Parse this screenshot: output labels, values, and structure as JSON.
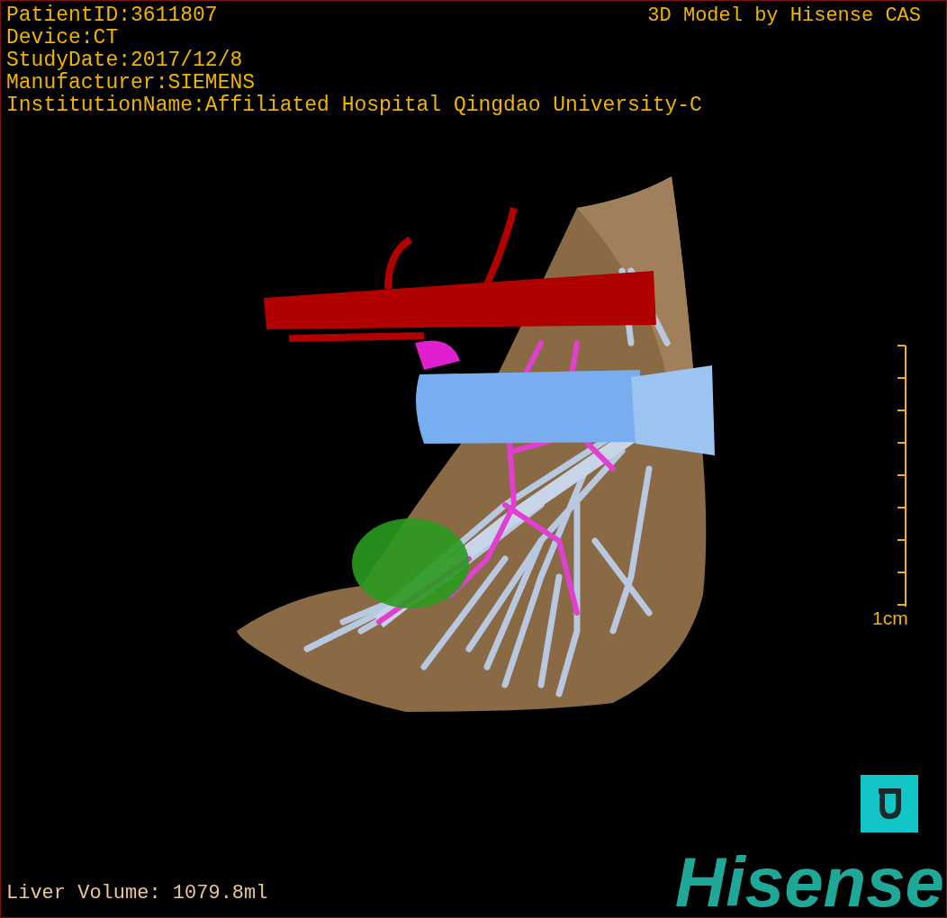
{
  "patient_info": [
    "PatientID:3611807",
    "Device:CT",
    "StudyDate:2017/12/8",
    "Manufacturer:SIEMENS",
    "InstitutionName:Affiliated Hospital Qingdao University-C"
  ],
  "viewer_title": "3D Model by Hisense CAS",
  "scale_bar": {
    "label": "1cm"
  },
  "liver_volume": "Liver Volume: 1079.8ml",
  "logo": {
    "text": "Hisense"
  }
}
